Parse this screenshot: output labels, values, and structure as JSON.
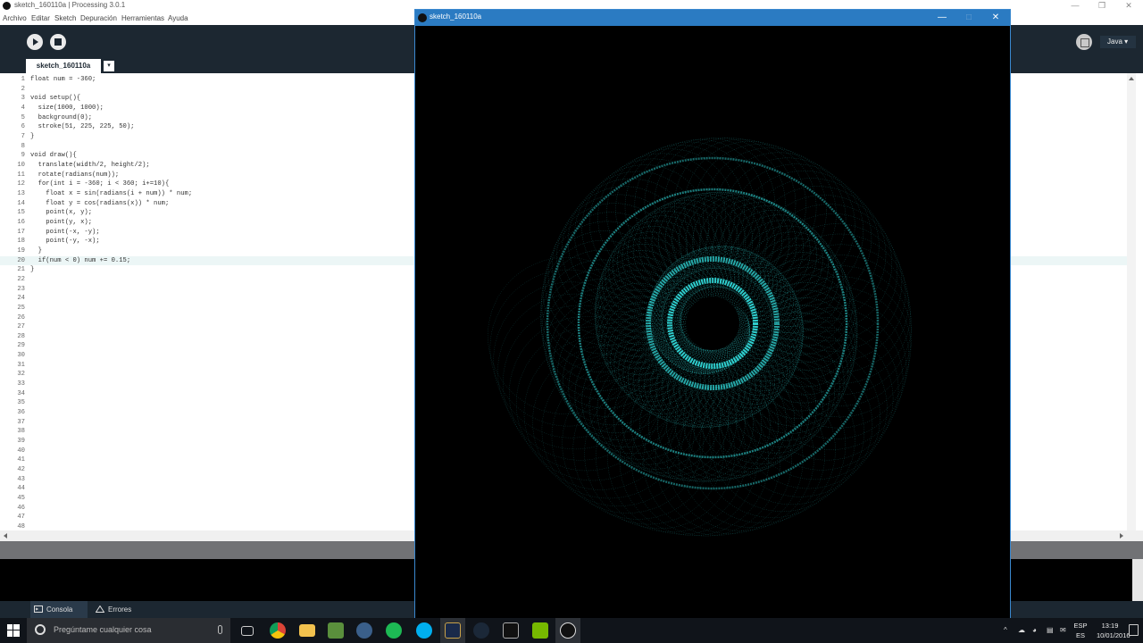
{
  "window": {
    "title": "sketch_160110a | Processing 3.0.1",
    "controls": [
      "—",
      "❒",
      "✕"
    ]
  },
  "menu": [
    "Archivo",
    "Editar",
    "Sketch",
    "Depuración",
    "Herramientas",
    "Ayuda"
  ],
  "toolbar": {
    "mode_label": "Java ▾",
    "run_icon": "play-icon",
    "stop_icon": "stop-icon"
  },
  "tab": {
    "label": "sketch_160110a",
    "menu_arrow": "▾"
  },
  "editor": {
    "current_line": 20,
    "lines": [
      "float num = -360;",
      "",
      "void setup(){",
      "  size(1000, 1000);",
      "  background(0);",
      "  stroke(51, 225, 225, 50);",
      "}",
      "",
      "void draw(){",
      "  translate(width/2, height/2);",
      "  rotate(radians(num));",
      "  for(int i = -360; i < 360; i+=10){",
      "    float x = sin(radians(i + num)) * num;",
      "    float y = cos(radians(x)) * num;",
      "    point(x, y);",
      "    point(y, x);",
      "    point(-x, -y);",
      "    point(-y, -x);",
      "  }",
      "  if(num < 0) num += 0.15;",
      "}",
      "",
      "",
      "",
      "",
      "",
      "",
      "",
      "",
      "",
      "",
      "",
      "",
      "",
      "",
      "",
      "",
      "",
      "",
      "",
      "",
      "",
      "",
      "",
      "",
      "",
      "",
      ""
    ]
  },
  "console": {
    "tabs": [
      {
        "label": "Consola",
        "icon": "console-icon",
        "active": true
      },
      {
        "label": "Errores",
        "icon": "warning-icon",
        "active": false
      }
    ]
  },
  "sketch_window": {
    "title": "sketch_160110a",
    "controls": [
      "—",
      "□",
      "✕"
    ],
    "stroke_color": "#33e1e1"
  },
  "taskbar": {
    "search_placeholder": "Pregúntame cualquier cosa",
    "apps": [
      "task-view-icon",
      "chrome-icon",
      "file-explorer-icon",
      "app-icon",
      "steam-like-icon",
      "spotify-icon",
      "skype-icon",
      "league-icon",
      "steam-icon",
      "processing-icon",
      "nvidia-icon",
      "processing-sketch-icon"
    ],
    "tray_symbols": [
      "^",
      "☁",
      "◕",
      "▤",
      "✉"
    ],
    "language": [
      "ESP",
      "ES"
    ],
    "time": "13:19",
    "date": "10/01/2016"
  }
}
